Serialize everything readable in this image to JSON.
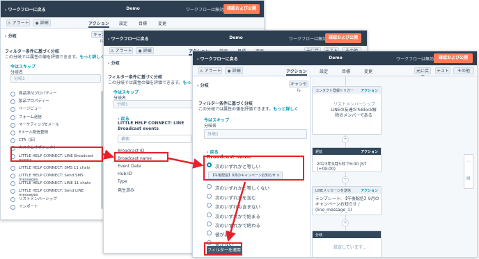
{
  "win1": {
    "back_label": "ワークフローに戻る",
    "title": "Demo",
    "status": "ワークフローは無効です",
    "publish_label": "確認および公開",
    "alert_label": "アラート",
    "detail_label": "詳細",
    "tabs": [
      "アクション",
      "設定",
      "目標",
      "変更"
    ],
    "panel_back": "分岐",
    "cancel_label": "キャンセル",
    "filter_heading": "フィルター条件に基づく分岐",
    "filter_desc": "この分岐では属性の値を評価できます。",
    "learn_more": "もっと詳しく",
    "skip_label": "今はスキップ",
    "branch_name_label": "分岐名",
    "branch_name_value": "分岐1",
    "events": [
      "商品添付プロパティー",
      "製品プロパティー",
      "ページビュー",
      "フォーム送信",
      "マーケティングEメール",
      "Eメール配信登録",
      "CTA（旧）",
      "カスタムオブジェクト",
      "LITTLE HELP CONNECT: LINE Broadcast events",
      "LITTLE HELP CONNECT: SMS 11 chats",
      "LITTLE HELP CONNECT: Send SMS messages",
      "LITTLE HELP CONNECT: LINE 11 chats",
      "LITTLE HELP CONNECT: Send LINE messages",
      "リストメンバーシップ",
      "インポート"
    ]
  },
  "win2": {
    "back_label": "ワークフローに戻る",
    "title": "Demo",
    "status": "ワークフローは無効です",
    "publish_label": "確認および公開",
    "alert_label": "アラート",
    "detail_label": "詳細",
    "tabs": [
      "アクション",
      "設定",
      "目標",
      "変更"
    ],
    "panel_back": "分岐",
    "filter_heading": "フィルター条件に基づく分岐",
    "filter_desc": "この分岐では属性の値を評価できます。",
    "learn_more": "もっと詳しく",
    "skip_label": "今はスキップ",
    "branch_name_label": "分岐名",
    "branch_name_value": "分岐1",
    "back_link": "戻る",
    "section_title": "LITTLE HELP CONNECT: LINE Broadcast events",
    "search_placeholder": "検索",
    "properties": [
      "Broadcast ID",
      "Broadcast name",
      "Event Date",
      "Hub ID",
      "Type",
      "発生済み"
    ],
    "undo_label": "元に戻す",
    "test_label": "テスト",
    "other_label": "その他"
  },
  "win3": {
    "back_label": "ワークフローに戻る",
    "title": "Demo",
    "status": "ワークフローは無効です",
    "publish_label": "確認および公開",
    "alert_label": "アラート",
    "detail_label": "詳細",
    "tabs": [
      "アクション",
      "設定",
      "目標",
      "変更"
    ],
    "undo_label": "元に戻す",
    "test_label": "テスト",
    "other_label": "その他",
    "panel_back": "分岐",
    "cancel_label": "キャンセル",
    "filter_heading": "フィルター条件に基づく分岐",
    "filter_desc": "この分岐では属性の値を評価できます。",
    "learn_more": "もっと詳しく",
    "skip_label": "今はスキップ",
    "branch_name_label": "分岐名",
    "branch_name_value": "分岐1",
    "back_link": "戻る",
    "field_title": "Broadcast name",
    "options": [
      "次のいずれかと等しい",
      "次のいずれかと等しくない",
      "次のいずれかを含む",
      "次のいずれも含まない",
      "次のいずれかで始まる",
      "次のいずれかで終わる",
      "値がある",
      "値がない"
    ],
    "selected_tag": "【午後配信】9月のキャンペーンお知らせ",
    "apply_label": "フィルターを適用",
    "canvas": {
      "trigger_title": "コンタクト登録トリガー",
      "action_label": "アクション",
      "trigger_sub": "リストメンバーシップ",
      "trigger_body": "LINEの友達だちBlock解除のメンバーである",
      "delay_title": "遅延",
      "delay_body": "2023年9月5日で6:00 JST (+09:00)",
      "line_title": "LINEメッセージを送信",
      "line_body": "テンプレート: 【午後配信】9月のキャンペーンお知らせ / (line_message_1)",
      "branch_title": "分岐",
      "branch_body": "設定しています..."
    }
  }
}
